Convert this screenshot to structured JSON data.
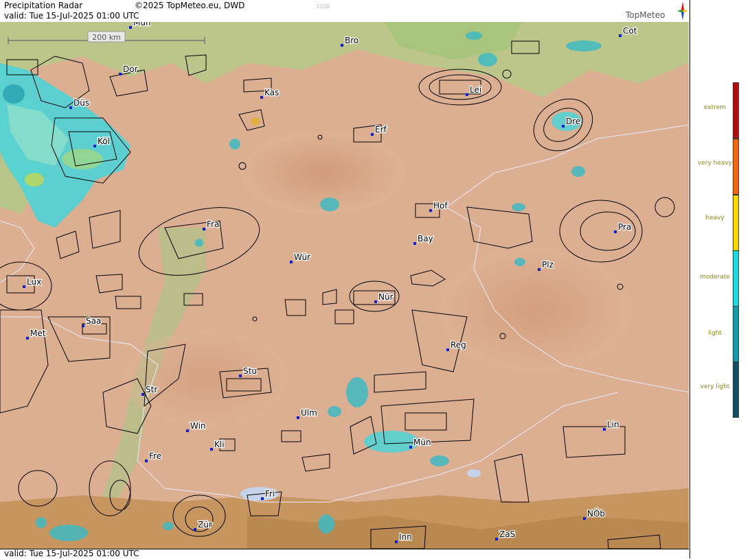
{
  "header": {
    "title": "Precipitation Radar",
    "valid": "valid:  Tue  15-Jul-2025 01:00 UTC",
    "copyright": "©2025 TopMeteo.eu, DWD",
    "code": "3100"
  },
  "logo": {
    "text": "TopMeteo",
    "icon": "compass-star-icon"
  },
  "footer": {
    "valid": "valid:  Tue  15-Jul-2025 01:00 UTC"
  },
  "scale": {
    "label": "200 km"
  },
  "legend": {
    "items": [
      {
        "label": "extrem",
        "color": "#b01010"
      },
      {
        "label": "very heavy",
        "color": "#ee6a10"
      },
      {
        "label": "heavy",
        "color": "#f7d800"
      },
      {
        "label": "moderate",
        "color": "#20d8e0"
      },
      {
        "label": "light",
        "color": "#1a9aa8"
      },
      {
        "label": "very light",
        "color": "#154d66"
      }
    ]
  },
  "cities": [
    {
      "name": "Mün"
    },
    {
      "name": "Bro"
    },
    {
      "name": "Cot"
    },
    {
      "name": "Dor"
    },
    {
      "name": "Kas"
    },
    {
      "name": "Lei"
    },
    {
      "name": "Düs"
    },
    {
      "name": "Dre"
    },
    {
      "name": "Erf"
    },
    {
      "name": "Köl"
    },
    {
      "name": "Hof"
    },
    {
      "name": "Fra"
    },
    {
      "name": "Pra"
    },
    {
      "name": "Bay"
    },
    {
      "name": "Wür"
    },
    {
      "name": "Plz"
    },
    {
      "name": "Lux"
    },
    {
      "name": "Nür"
    },
    {
      "name": "Saa"
    },
    {
      "name": "Met"
    },
    {
      "name": "Reg"
    },
    {
      "name": "Stu"
    },
    {
      "name": "Str"
    },
    {
      "name": "Ulm"
    },
    {
      "name": "Win"
    },
    {
      "name": "Kli"
    },
    {
      "name": "Mün"
    },
    {
      "name": "Lin"
    },
    {
      "name": "Fre"
    },
    {
      "name": "Fri"
    },
    {
      "name": "NÖb"
    },
    {
      "name": "Zür"
    },
    {
      "name": "ZaS"
    },
    {
      "name": "Inn"
    }
  ]
}
